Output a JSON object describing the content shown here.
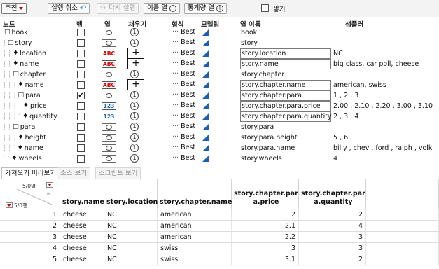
{
  "toolbar": {
    "recommend": "추천",
    "undo": "실행 취소",
    "redo": "다시 실행",
    "name_col": "이름 열",
    "stat_col": "통계량 열",
    "stack": "쌓기"
  },
  "headers": {
    "node": "노드",
    "row": "행",
    "col": "열",
    "fill": "채우기",
    "format": "형식",
    "modeling": "모델링",
    "colname": "열 이름",
    "sampler": "샘플러"
  },
  "tree": [
    {
      "indent": "",
      "marker": "□",
      "label": "book",
      "row": false,
      "coltype": "blank",
      "typetext": "",
      "fill": "1",
      "format": "Best",
      "colname": "book",
      "boxed": false,
      "sample": ""
    },
    {
      "indent": "┊",
      "marker": "□",
      "label": "story",
      "row": false,
      "coltype": "blank",
      "typetext": "",
      "fill": "1",
      "format": "Best",
      "colname": "story",
      "boxed": false,
      "sample": ""
    },
    {
      "indent": "┊ ┊",
      "marker": "♦",
      "label": "location",
      "row": false,
      "coltype": "abc",
      "typetext": "ABC",
      "fill": "+",
      "format": "Best",
      "colname": "story.location",
      "boxed": true,
      "sample": "NC"
    },
    {
      "indent": "┊ ┊",
      "marker": "♦",
      "label": "name",
      "row": false,
      "coltype": "abc",
      "typetext": "ABC",
      "fill": "+",
      "format": "Best",
      "colname": "story.name",
      "boxed": true,
      "sample": "big class, car poll, cheese"
    },
    {
      "indent": "┊ ┊",
      "marker": "□",
      "label": "chapter",
      "row": false,
      "coltype": "blank",
      "typetext": "",
      "fill": "1",
      "format": "Best",
      "colname": "story.chapter",
      "boxed": false,
      "sample": ""
    },
    {
      "indent": "┊ ┊ ┊",
      "marker": "♦",
      "label": "name",
      "row": false,
      "coltype": "abc",
      "typetext": "ABC",
      "fill": "+",
      "format": "Best",
      "colname": "story.chapter.name",
      "boxed": true,
      "sample": "american, swiss"
    },
    {
      "indent": "┊ ┊ ┊",
      "marker": "□",
      "label": "para",
      "row": true,
      "coltype": "blank",
      "typetext": "",
      "fill": "1",
      "format": "Best",
      "colname": "story.chapter.para",
      "boxed": true,
      "sample": "1 , 2 , 3"
    },
    {
      "indent": "┊ ┊ ┊ ┊",
      "marker": "♦",
      "label": "price",
      "row": false,
      "coltype": "num",
      "typetext": "123",
      "fill": "1",
      "format": "Best",
      "colname": "story.chapter.para.price",
      "boxed": true,
      "sample": "2.00 , 2.10 , 2.20 , 3.00 , 3.10"
    },
    {
      "indent": "┊ ┊ ┊ ˋ",
      "marker": "♦",
      "label": "quantity",
      "row": false,
      "coltype": "num",
      "typetext": "123",
      "fill": "1",
      "format": "Best",
      "colname": "story.chapter.para.quantity",
      "boxed": true,
      "sample": "2 , 3 , 4"
    },
    {
      "indent": "┊ ┊",
      "marker": "□",
      "label": "para",
      "row": false,
      "coltype": "blank",
      "typetext": "",
      "fill": "1",
      "format": "Best",
      "colname": "story.para",
      "boxed": false,
      "sample": ""
    },
    {
      "indent": "┊ ┊ ┊",
      "marker": "♦",
      "label": "height",
      "row": false,
      "coltype": "blank",
      "typetext": "",
      "fill": "1",
      "format": "Best",
      "colname": "story.para.height",
      "boxed": false,
      "sample": "5 , 6"
    },
    {
      "indent": "┊ ┊ ˋ",
      "marker": "♦",
      "label": "name",
      "row": false,
      "coltype": "blank",
      "typetext": "",
      "fill": "1",
      "format": "Best",
      "colname": "story.para.name",
      "boxed": false,
      "sample": "billy , chev , ford , ralph , volk"
    },
    {
      "indent": "ˋ ˋ",
      "marker": "♦",
      "label": "wheels",
      "row": false,
      "coltype": "blank",
      "typetext": "",
      "fill": "1",
      "format": "Best",
      "colname": "story.wheels",
      "boxed": false,
      "sample": "4"
    }
  ],
  "tabs": [
    "가져오기 미리보기",
    "소스 보기",
    "스크립트 보기"
  ],
  "preview": {
    "cols_label": "5/0열",
    "rows_label": "5/0행",
    "columns": [
      "story.name",
      "story.location",
      "story.chapter.name",
      "story.chapter.par\na.price",
      "story.chapter.par\na.quantity"
    ],
    "rows": [
      [
        "1",
        "cheese",
        "NC",
        "american",
        "2",
        "2"
      ],
      [
        "2",
        "cheese",
        "NC",
        "american",
        "2.1",
        "4"
      ],
      [
        "3",
        "cheese",
        "NC",
        "american",
        "2.2",
        "3"
      ],
      [
        "4",
        "cheese",
        "NC",
        "swiss",
        "3",
        "3"
      ],
      [
        "5",
        "cheese",
        "NC",
        "swiss",
        "3.1",
        "2"
      ]
    ]
  }
}
